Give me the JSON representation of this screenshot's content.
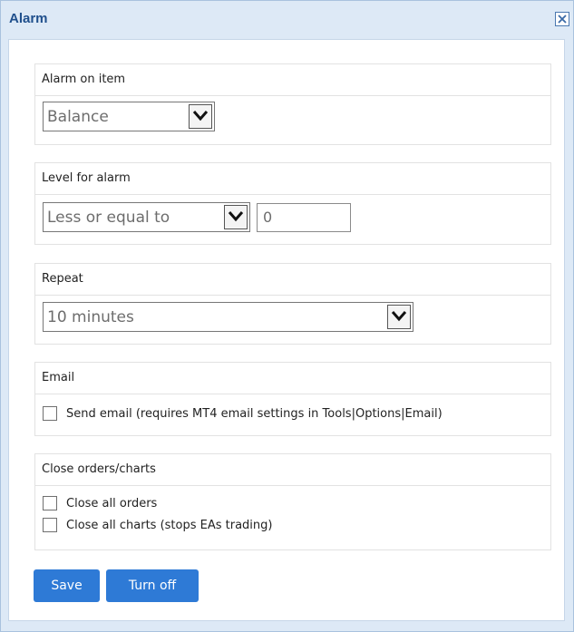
{
  "window": {
    "title": "Alarm",
    "close_icon": "close-icon"
  },
  "sections": {
    "item": {
      "header": "Alarm on item",
      "selected": "Balance"
    },
    "level": {
      "header": "Level for alarm",
      "comparison": "Less or equal to",
      "value": "0"
    },
    "repeat": {
      "header": "Repeat",
      "selected": "10 minutes"
    },
    "email": {
      "header": "Email",
      "send_email_label": "Send email (requires MT4 email settings in Tools|Options|Email)",
      "send_email_checked": false
    },
    "close": {
      "header": "Close orders/charts",
      "close_orders_label": "Close all orders",
      "close_orders_checked": false,
      "close_charts_label": "Close all charts (stops EAs trading)",
      "close_charts_checked": false
    }
  },
  "buttons": {
    "save": "Save",
    "turn_off": "Turn off"
  },
  "colors": {
    "accent": "#2e7ad6",
    "title_text": "#1f4f8c",
    "window_bg": "#dde9f6"
  }
}
